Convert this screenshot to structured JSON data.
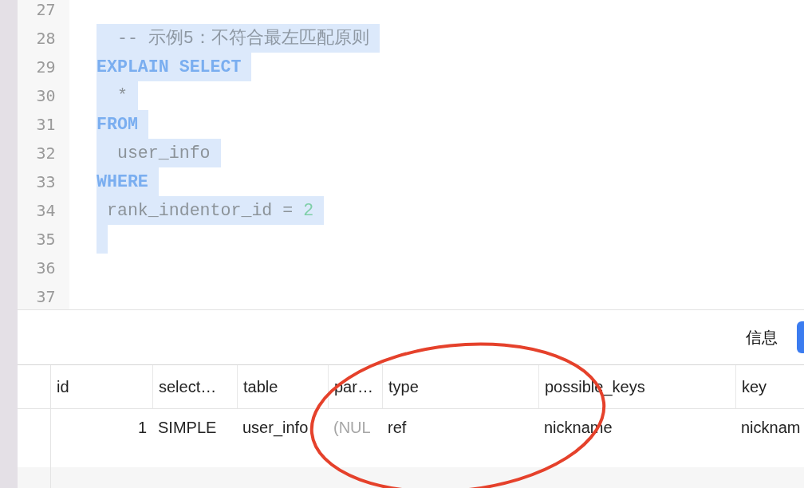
{
  "editor": {
    "lines": [
      {
        "number": "27",
        "selected": false
      },
      {
        "number": "28",
        "selected": true,
        "tokens": [
          {
            "kind": "comment",
            "text": "  -- 示例5：不符合最左匹配原则"
          }
        ]
      },
      {
        "number": "29",
        "selected": true,
        "tokens": [
          {
            "kind": "keyword",
            "text": "EXPLAIN SELECT"
          }
        ]
      },
      {
        "number": "30",
        "selected": true,
        "tokens": [
          {
            "kind": "plain",
            "text": "  *"
          }
        ]
      },
      {
        "number": "31",
        "selected": true,
        "tokens": [
          {
            "kind": "keyword",
            "text": "FROM"
          }
        ]
      },
      {
        "number": "32",
        "selected": true,
        "tokens": [
          {
            "kind": "plain",
            "text": "  user_info"
          }
        ]
      },
      {
        "number": "33",
        "selected": true,
        "tokens": [
          {
            "kind": "keyword",
            "text": "WHERE"
          }
        ]
      },
      {
        "number": "34",
        "selected": true,
        "tokens": [
          {
            "kind": "plain",
            "text": " rank_indentor_id = "
          },
          {
            "kind": "number",
            "text": "2"
          }
        ]
      },
      {
        "number": "35",
        "selected": true
      },
      {
        "number": "36",
        "selected": false
      },
      {
        "number": "37",
        "selected": false
      }
    ]
  },
  "toolbar": {
    "info_tab": "信息"
  },
  "result_table": {
    "columns": [
      "id",
      "select…",
      "table",
      "par…",
      "type",
      "possible_keys",
      "key"
    ],
    "rows": [
      [
        {
          "kind": "number",
          "text": "1"
        },
        {
          "kind": "text",
          "text": "SIMPLE"
        },
        {
          "kind": "text",
          "text": "user_info"
        },
        {
          "kind": "null",
          "text": "(NUL"
        },
        {
          "kind": "text",
          "text": "ref"
        },
        {
          "kind": "text",
          "text": "nickname"
        },
        {
          "kind": "text",
          "text": "nicknam"
        }
      ]
    ]
  },
  "annotation": {
    "kind": "ellipse",
    "color": "#e5412b"
  }
}
